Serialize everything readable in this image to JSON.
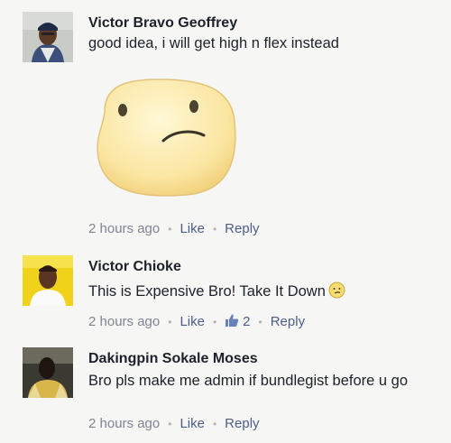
{
  "comments": [
    {
      "author": "Victor Bravo Geoffrey",
      "text": "good idea, i will get high n flex instead",
      "sticker": "confused-face-sticker",
      "time": "2 hours ago",
      "like_label": "Like",
      "reply_label": "Reply"
    },
    {
      "author": "Victor Chioke",
      "text": "This is Expensive Bro! Take It Down",
      "emoji": "confused-face-emoji",
      "time": "2 hours ago",
      "like_label": "Like",
      "likes_count": "2",
      "reply_label": "Reply"
    },
    {
      "author": "Dakingpin Sokale Moses",
      "text": "Bro pls make me admin if bundlegist before u go",
      "time": "2 hours ago",
      "like_label": "Like",
      "reply_label": "Reply"
    }
  ],
  "colors": {
    "background": "#f6f6f4",
    "author": "#1d2129",
    "link": "#4b5f86",
    "meta": "#7f8490",
    "like_icon": "#6b82b8"
  }
}
